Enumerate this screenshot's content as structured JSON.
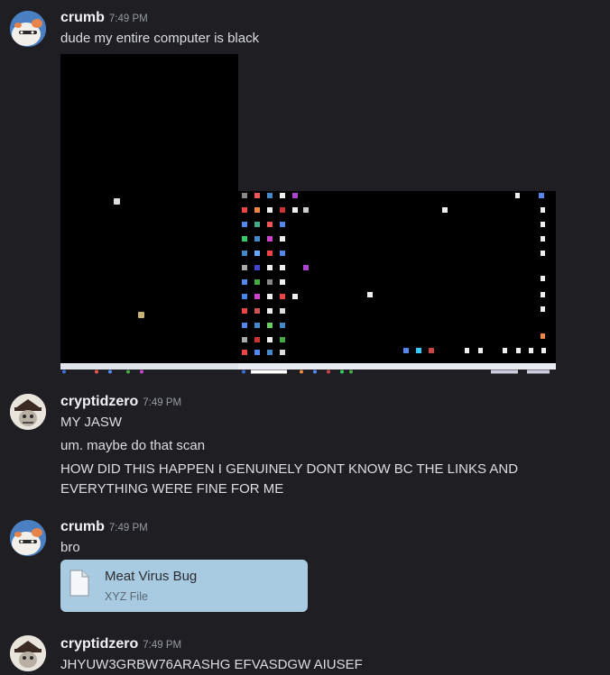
{
  "messages": [
    {
      "username": "crumb",
      "time": "7:49 PM",
      "lines": [
        "dude my entire computer is black"
      ],
      "attachment_icon": "screenshot-image"
    },
    {
      "username": "cryptidzero",
      "time": "7:49 PM",
      "lines": [
        "MY JASW",
        "um. maybe do that scan",
        "HOW DID THIS HAPPEN I GENUINELY DONT KNOW BC THE LINKS AND EVERYTHING WERE FINE FOR ME"
      ]
    },
    {
      "username": "crumb",
      "time": "7:49 PM",
      "lines": [
        "bro"
      ],
      "file": {
        "name": "Meat Virus Bug",
        "type": "XYZ File",
        "icon": "file-icon"
      }
    },
    {
      "username": "cryptidzero",
      "time": "7:49 PM",
      "lines": [
        "JHYUW3GRBW76ARASHG EFVASDGW AIUSEF"
      ]
    }
  ],
  "colors": {
    "background": "#1f1f23",
    "username": "#f2f3f5",
    "timestamp": "#949ba4",
    "text": "#dbdee1",
    "file_card": "#a9cbe2"
  }
}
